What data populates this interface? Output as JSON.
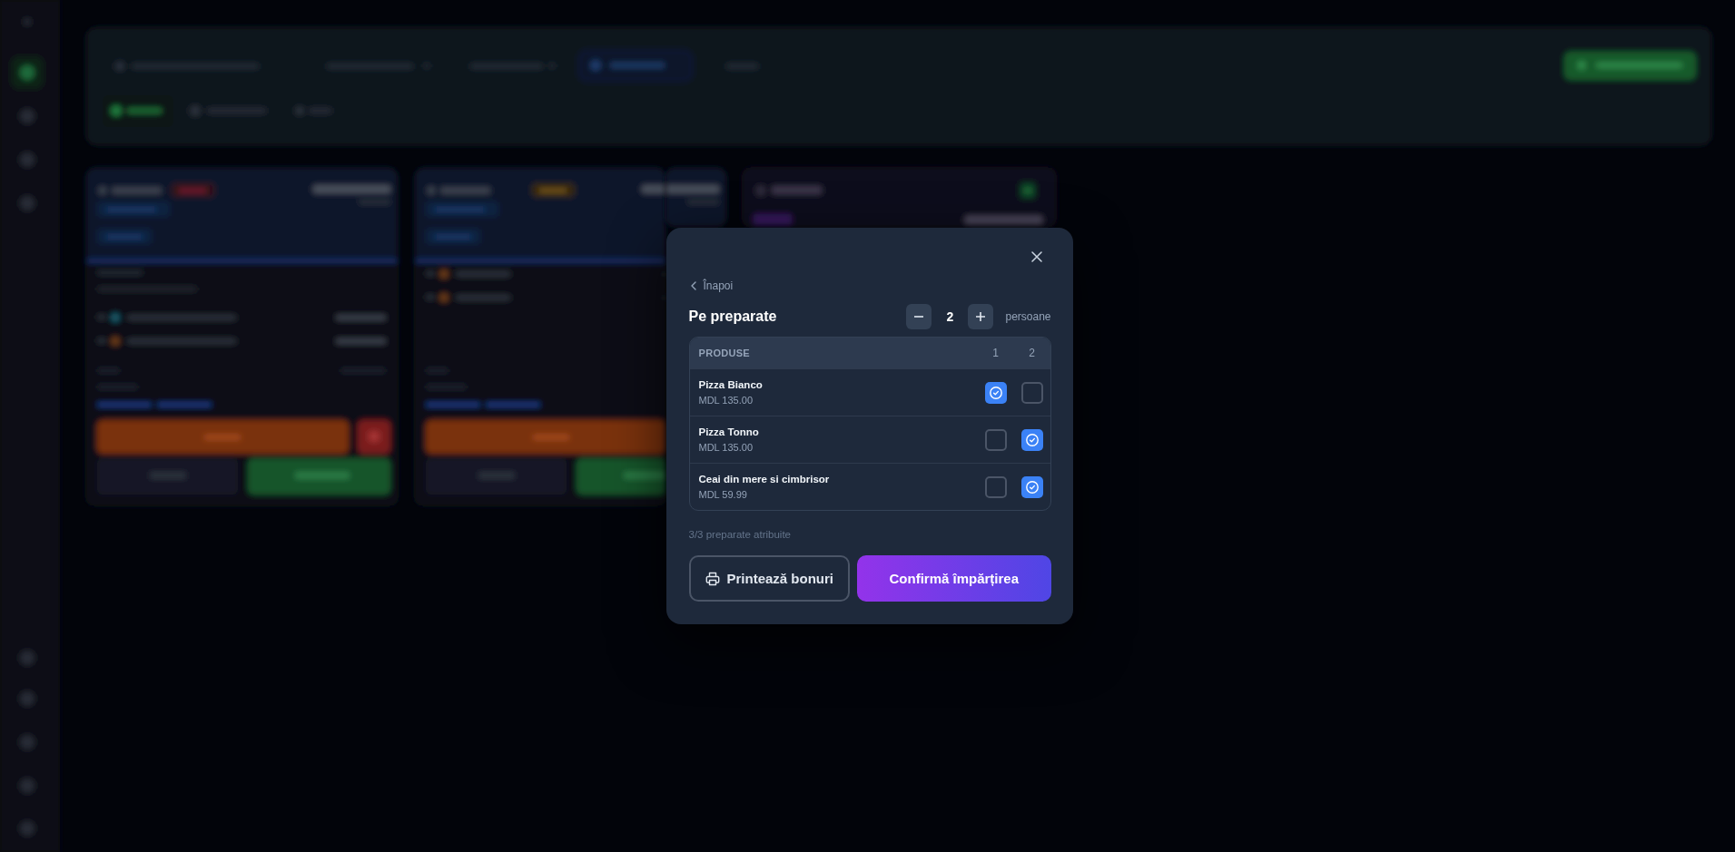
{
  "dialog": {
    "back_link": "Înapoi",
    "title": "Pe preparate",
    "people": {
      "count": "2",
      "unit": "persoane"
    },
    "table": {
      "columns": [
        "PRODUSE",
        "1",
        "2"
      ],
      "rows": [
        {
          "name": "Pizza Bianco",
          "price": "MDL 135.00",
          "checks": [
            {
              "checked": true
            },
            {
              "checked": false
            }
          ]
        },
        {
          "name": "Pizza Tonno",
          "price": "MDL 135.00",
          "checks": [
            {
              "checked": false
            },
            {
              "checked": true
            }
          ]
        },
        {
          "name": "Ceai din mere si cimbrisor",
          "price": "MDL 59.99",
          "checks": [
            {
              "checked": false
            },
            {
              "checked": true
            }
          ]
        }
      ]
    },
    "summary": "3/3 preparate atribuite",
    "buttons": [
      {
        "label": "Printează bonuri",
        "kind": "print"
      },
      {
        "label": "Confirmă împărțirea",
        "kind": "confirm"
      }
    ]
  }
}
